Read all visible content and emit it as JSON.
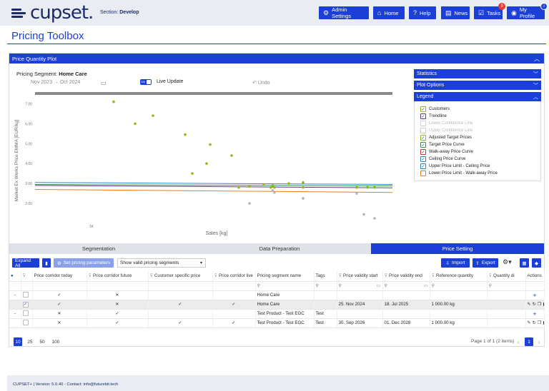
{
  "header": {
    "logo_text": "cupset",
    "section_prefix": "Section:",
    "section_value": "Develop",
    "buttons": [
      {
        "label": "Admin Settings",
        "icon": "gear-icon",
        "glyph": "⚙"
      },
      {
        "label": "Home",
        "icon": "home-icon",
        "glyph": "⌂"
      },
      {
        "label": "Help",
        "icon": "help-icon",
        "glyph": "?"
      },
      {
        "label": "News",
        "icon": "news-icon",
        "glyph": "▤"
      },
      {
        "label": "Tasks",
        "icon": "tasks-icon",
        "glyph": "☑"
      },
      {
        "label": "My Profile",
        "icon": "profile-icon",
        "glyph": "◉"
      }
    ],
    "tasks_badge": "3",
    "profile_badge": "i"
  },
  "page": {
    "title": "Pricing Toolbox"
  },
  "panel": {
    "title": "Price Quantity Plot",
    "segment_label": "Pricing Segment:",
    "segment_value": "Home Care",
    "date_range": "Nov 2023  →  Oct 2024",
    "toggle_text": "ON",
    "live_update": "Live Update",
    "undo": "Undo"
  },
  "accordions": {
    "statistics": "Statistics",
    "plot_options": "Plot Options",
    "legend": "Legend"
  },
  "legend_items": [
    {
      "label": "Customers",
      "checked": true,
      "enabled": true,
      "color": "#8db81e"
    },
    {
      "label": "Trendline",
      "checked": true,
      "enabled": true,
      "color": "#5c3b8c"
    },
    {
      "label": "Lower Confidence Line",
      "checked": false,
      "enabled": false,
      "color": "#bbbbbb"
    },
    {
      "label": "Upper Confidence Line",
      "checked": false,
      "enabled": false,
      "color": "#bbbbbb"
    },
    {
      "label": "Adjusted Target Prices",
      "checked": true,
      "enabled": true,
      "color": "#8db81e"
    },
    {
      "label": "Target Price Curve",
      "checked": true,
      "enabled": true,
      "color": "#3e8f3e"
    },
    {
      "label": "Walk-away Price Curve",
      "checked": true,
      "enabled": true,
      "color": "#c0392b"
    },
    {
      "label": "Ceiling Price Curve",
      "checked": true,
      "enabled": true,
      "color": "#2a86c9"
    },
    {
      "label": "Upper Price Limit - Ceiling Price",
      "checked": true,
      "enabled": true,
      "color": "#2a86c9"
    },
    {
      "label": "Lower Price Limit - Walk-away Price",
      "checked": false,
      "enabled": true,
      "color": "#e67e22"
    }
  ],
  "chart_data": {
    "type": "scatter",
    "xlabel": "Sales [kg]",
    "ylabel": "Market Ex Works Price EMMA [EUR/kg]",
    "y_ticks": [
      "7.00",
      "6.00",
      "5.00",
      "4.00",
      "3.00",
      "2.00"
    ],
    "x_ticks": [
      "1K"
    ],
    "ylim": [
      1.0,
      7.3
    ],
    "series": [
      {
        "name": "Customers",
        "color": "#8db81e",
        "points": [
          [
            0.22,
            7.1
          ],
          [
            0.28,
            6.0
          ],
          [
            0.33,
            6.4
          ],
          [
            0.42,
            5.45
          ],
          [
            0.49,
            4.95
          ],
          [
            0.48,
            4.0
          ],
          [
            0.55,
            4.4
          ],
          [
            0.44,
            3.5
          ],
          [
            0.6,
            2.85
          ],
          [
            0.57,
            2.8
          ],
          [
            0.64,
            2.95
          ],
          [
            0.66,
            2.8
          ],
          [
            0.665,
            2.9
          ],
          [
            0.67,
            2.8
          ],
          [
            0.71,
            3.0
          ],
          [
            0.75,
            2.8
          ],
          [
            0.75,
            3.05
          ],
          [
            0.9,
            2.8
          ],
          [
            0.93,
            2.8
          ],
          [
            0.95,
            2.8
          ]
        ]
      },
      {
        "name": "Excluded",
        "color": "#b5b5b5",
        "points": [
          [
            0.6,
            2.0
          ],
          [
            0.665,
            2.65
          ],
          [
            0.67,
            2.55
          ],
          [
            0.75,
            2.25
          ],
          [
            0.9,
            2.5
          ],
          [
            0.92,
            1.45
          ],
          [
            0.95,
            1.25
          ]
        ]
      }
    ],
    "curves": [
      {
        "name": "Ceiling Price Curve",
        "color": "#2a86c9",
        "y": [
          3.05,
          2.95
        ]
      },
      {
        "name": "Target Price Curve",
        "color": "#3e8f3e",
        "y": [
          2.95,
          2.88
        ]
      },
      {
        "name": "Trendline",
        "color": "#5c3b8c",
        "y": [
          2.9,
          2.78
        ]
      },
      {
        "name": "Walk-away Price Curve",
        "color": "#e67e22",
        "y": [
          2.7,
          2.55
        ]
      }
    ]
  },
  "tabs": [
    {
      "label": "Segmentation",
      "active": false
    },
    {
      "label": "Data Preparation",
      "active": false
    },
    {
      "label": "Price Setting",
      "active": true
    }
  ],
  "toolbar": {
    "expand_all": "Expand All",
    "set_params": "Set pricing parameters",
    "segment_filter": "Show valid pricing segments",
    "import": "Import",
    "export": "Export"
  },
  "table": {
    "columns": [
      "Price corridor today",
      "Price corridor future",
      "Customer specific price",
      "Price corridor live",
      "Pricing segment name",
      "Tags",
      "Price validity start",
      "Price validity end",
      "Reference quantity",
      "Quantity di",
      "Actions"
    ],
    "rows": [
      {
        "expand": "-",
        "check": false,
        "today": "✓",
        "future": "✕",
        "specific": "",
        "live": "",
        "name": "Home Care",
        "tags": "",
        "start": "",
        "end": "",
        "refqty": "",
        "qty": "",
        "action": "plus",
        "sel": false
      },
      {
        "expand": "",
        "check": true,
        "today": "✓",
        "future": "✕",
        "specific": "✓",
        "live": "✓",
        "name": "Home Care",
        "tags": "",
        "start": "25. Nov 2024",
        "end": "18. Jul 2025",
        "refqty": "1 000.00 kg",
        "qty": "",
        "action": "tools",
        "sel": true
      },
      {
        "expand": "-",
        "check": false,
        "today": "✕",
        "future": "✓",
        "specific": "",
        "live": "",
        "name": "Test Product - Test EGC",
        "tags": "Test",
        "start": "",
        "end": "",
        "refqty": "",
        "qty": "",
        "action": "plus",
        "sel": false
      },
      {
        "expand": "",
        "check": false,
        "today": "✕",
        "future": "✓",
        "specific": "✓",
        "live": "✓",
        "name": "Test Product - Test EGC",
        "tags": "Test",
        "start": "30. Sep 2026",
        "end": "01. Dec 2028",
        "refqty": "1 000.00 kg",
        "qty": "",
        "action": "tools",
        "sel": false
      }
    ]
  },
  "pager": {
    "sizes": [
      "10",
      "25",
      "50",
      "100"
    ],
    "info": "Page 1 of 1 (2 items)",
    "current": "1"
  },
  "footer": {
    "text": "CUPSET+ | Version: 5.0.40 - Contact: info@futurebit.tech"
  }
}
